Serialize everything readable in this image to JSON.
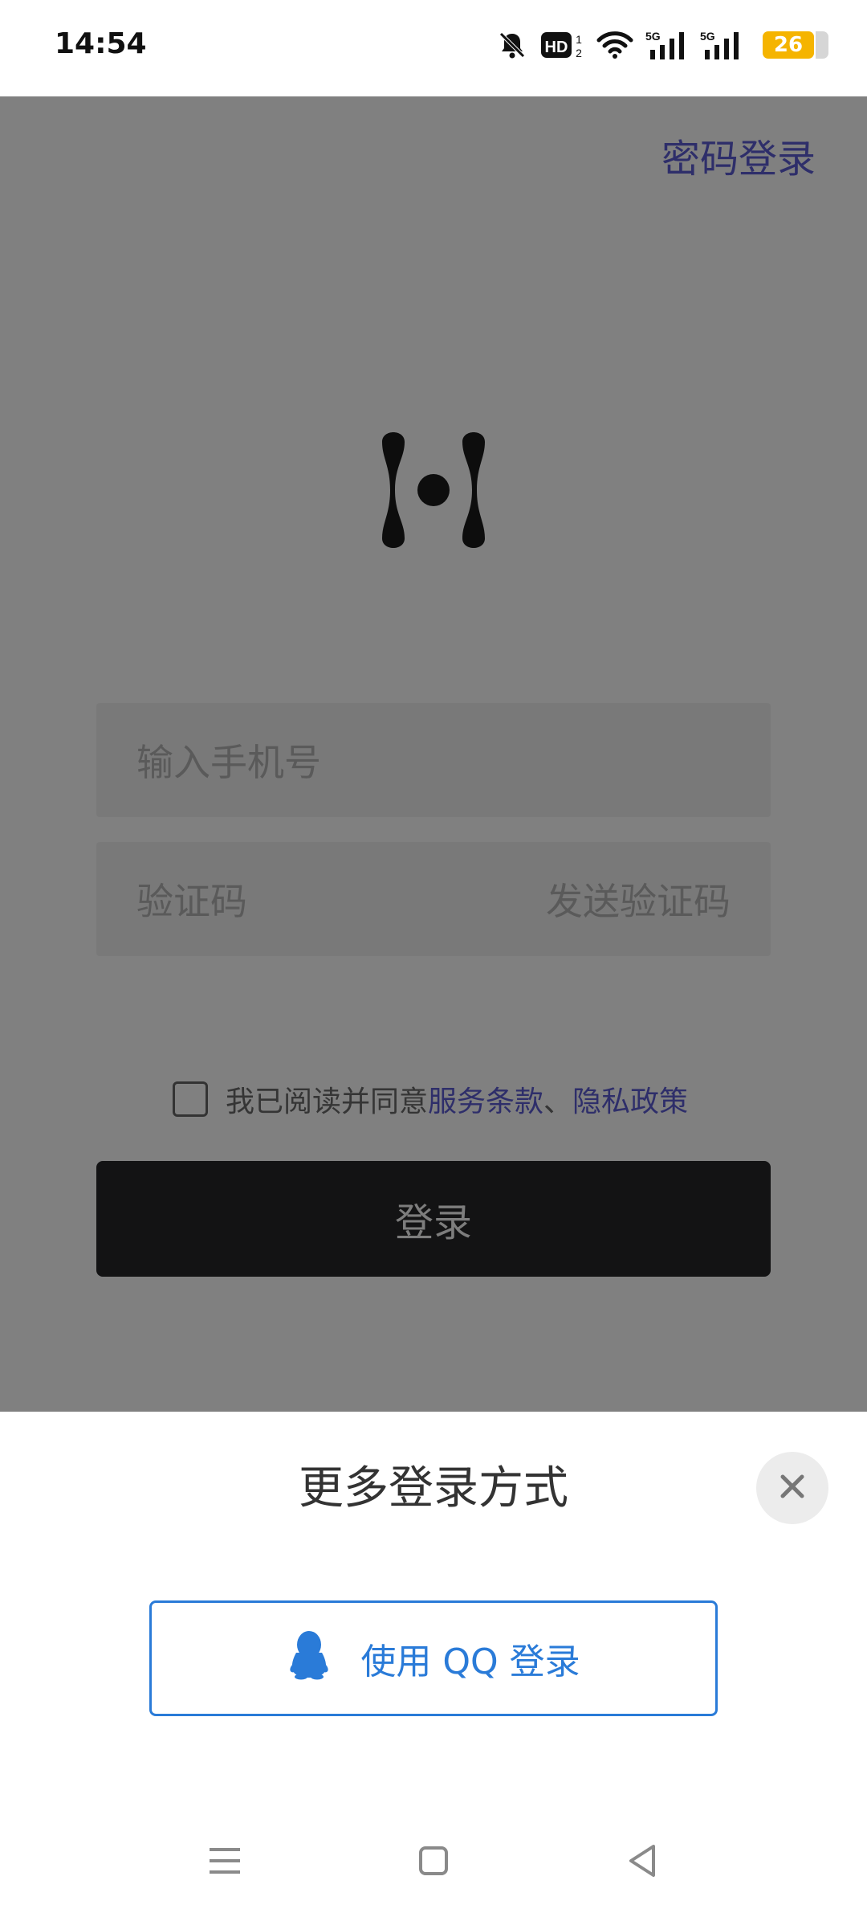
{
  "status_bar": {
    "time": "14:54",
    "icons": [
      "bell-off-icon",
      "hd-icon",
      "wifi-icon",
      "signal-5g-icon",
      "signal-5g-icon",
      "battery-icon"
    ],
    "hd_label": "HD",
    "net_label_1": "5G",
    "net_label_2": "5G",
    "battery_level": "26"
  },
  "main": {
    "password_login": "密码登录",
    "logo_icon": "app-logo-icon",
    "phone_placeholder": "输入手机号",
    "code_placeholder": "验证码",
    "send_code": "发送验证码",
    "agreement": {
      "prefix": "我已阅读并同意",
      "terms": "服务条款",
      "separator": "、",
      "privacy": "隐私政策",
      "checked": false
    },
    "login_button": "登录"
  },
  "sheet": {
    "title": "更多登录方式",
    "close_icon": "close-icon",
    "qq_button": "使用 QQ 登录",
    "qq_icon": "qq-penguin-icon"
  },
  "nav_bar": {
    "items": [
      "menu-icon",
      "home-square-icon",
      "back-triangle-icon"
    ]
  },
  "colors": {
    "accent": "#2a7bd8",
    "link": "#2e2e6a",
    "overlay": "#808080",
    "battery": "#f5b400"
  }
}
